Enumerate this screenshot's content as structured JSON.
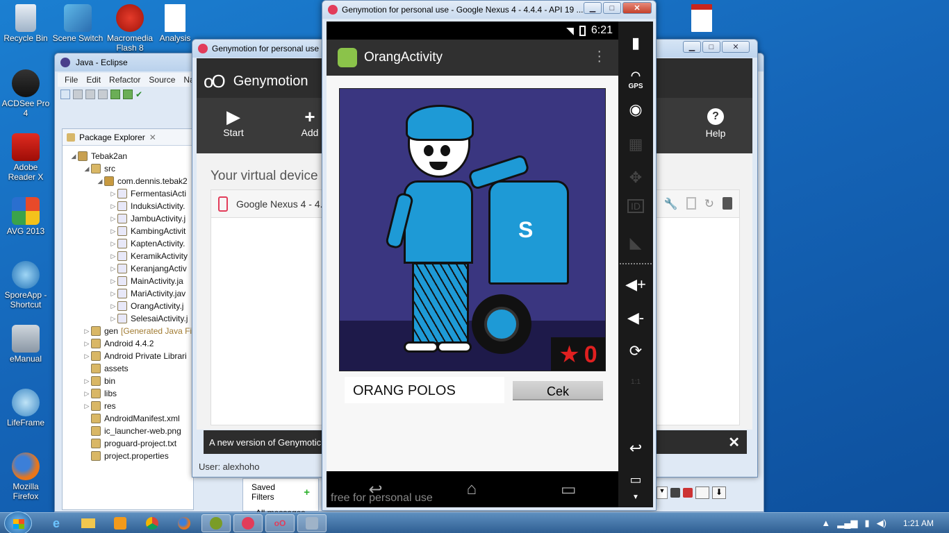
{
  "desktop": {
    "icons": [
      {
        "label": "Recycle Bin"
      },
      {
        "label": "Scene Switch"
      },
      {
        "label": "Macromedia Flash 8"
      },
      {
        "label": "Analysis"
      },
      {
        "label": "ACDSee Pro 4"
      },
      {
        "label": "Adobe Reader X"
      },
      {
        "label": "AVG 2013"
      },
      {
        "label": "SporeApp - Shortcut"
      },
      {
        "label": "eManual"
      },
      {
        "label": "LifeFrame"
      },
      {
        "label": "Mozilla Firefox"
      }
    ]
  },
  "eclipse": {
    "title": "Java - Eclipse",
    "menu": [
      "File",
      "Edit",
      "Refactor",
      "Source",
      "Na"
    ],
    "package_explorer_tab": "Package Explorer",
    "tree": [
      {
        "label": "Tebak2an",
        "indent": 0,
        "twisty": "◢"
      },
      {
        "label": "src",
        "indent": 1,
        "twisty": "◢"
      },
      {
        "label": "com.dennis.tebak2",
        "indent": 2,
        "twisty": "◢"
      },
      {
        "label": "FermentasiActi",
        "indent": 3,
        "twisty": "▷"
      },
      {
        "label": "InduksiActivity.",
        "indent": 3,
        "twisty": "▷"
      },
      {
        "label": "JambuActivity.j",
        "indent": 3,
        "twisty": "▷"
      },
      {
        "label": "KambingActivit",
        "indent": 3,
        "twisty": "▷"
      },
      {
        "label": "KaptenActivity.",
        "indent": 3,
        "twisty": "▷"
      },
      {
        "label": "KeramikActivity",
        "indent": 3,
        "twisty": "▷"
      },
      {
        "label": "KeranjangActiv",
        "indent": 3,
        "twisty": "▷"
      },
      {
        "label": "MainActivity.ja",
        "indent": 3,
        "twisty": "▷"
      },
      {
        "label": "MariActivity.jav",
        "indent": 3,
        "twisty": "▷"
      },
      {
        "label": "OrangActivity.j",
        "indent": 3,
        "twisty": "▷"
      },
      {
        "label": "SelesaiActivity.j",
        "indent": 3,
        "twisty": "▷"
      },
      {
        "label": "gen",
        "indent": 1,
        "twisty": "▷",
        "suffix": "[Generated Java Fi"
      },
      {
        "label": "Android 4.4.2",
        "indent": 1,
        "twisty": "▷"
      },
      {
        "label": "Android Private Librari",
        "indent": 1,
        "twisty": "▷"
      },
      {
        "label": "assets",
        "indent": 1,
        "twisty": ""
      },
      {
        "label": "bin",
        "indent": 1,
        "twisty": "▷"
      },
      {
        "label": "libs",
        "indent": 1,
        "twisty": "▷"
      },
      {
        "label": "res",
        "indent": 1,
        "twisty": "▷"
      },
      {
        "label": "AndroidManifest.xml",
        "indent": 1,
        "twisty": ""
      },
      {
        "label": "ic_launcher-web.png",
        "indent": 1,
        "twisty": ""
      },
      {
        "label": "proguard-project.txt",
        "indent": 1,
        "twisty": ""
      },
      {
        "label": "project.properties",
        "indent": 1,
        "twisty": ""
      }
    ],
    "saved_filters": "Saved Filters",
    "all_messages": "All messages (no"
  },
  "geny_manager": {
    "title": "Genymotion for personal use",
    "brand": "Genymotion",
    "start_label": "Start",
    "add_label": "Add",
    "help_label": "Help",
    "section_title": "Your virtual device",
    "device_name": "Google Nexus 4 - 4.4.",
    "notice": "A new version of Genymotic",
    "user": "User: alexhoho"
  },
  "phone": {
    "title": "Genymotion for personal use - Google Nexus 4 - 4.4.4 - API 19 ...",
    "time": "6:21",
    "app_title": "OrangActivity",
    "score": "0",
    "answer_text": "ORANG POLOS",
    "check_button": "Cek",
    "watermark": "free for personal use",
    "sidebar_gps": "GPS",
    "sidebar_id": "ID",
    "sidebar_ratio": "1:1"
  },
  "taskbar": {
    "clock": "1:21 AM"
  }
}
